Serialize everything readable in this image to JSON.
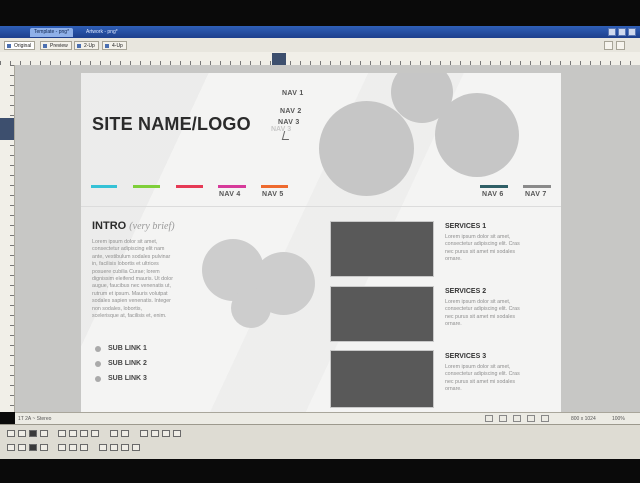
{
  "app": {
    "doc_tabs": [
      "Template - png*",
      "Artwork - png*"
    ],
    "view_buttons": [
      "Original",
      "Preview",
      "2-Up",
      "4-Up"
    ],
    "status": {
      "left": "1T 2A ~ Stereo",
      "size": "800 x 1024",
      "zoom": "100%"
    }
  },
  "design": {
    "logo": "SITE NAME/LOGO",
    "nav_top": [
      "NAV 1",
      "NAV 2",
      "NAV 3"
    ],
    "nav_bottom_left": [
      "NAV 4",
      "NAV 5"
    ],
    "nav_bottom_right": [
      "NAV 6",
      "NAV 7"
    ],
    "color_bars": [
      "#35c2d6",
      "#7fcf3a",
      "#e63a55",
      "#d63a9a",
      "#ee6a2e",
      "#2f5f66",
      "#8a8a8a"
    ],
    "intro_title": "INTRO",
    "intro_sub": "(very brief)",
    "intro_text": [
      "Lorem ipsum dolor sit amet,",
      "consectetur adipiscing elit nam",
      "ante, vestibulum sodales pulvinar",
      "in, facilisis lobortis et ultrices",
      "posuere cubilia Curae; lorem",
      "dignissim eleifend mauris. Ut dolor",
      "augue, faucibus nec venenatis ut,",
      "rutrum et ipsum. Mauris volutpat",
      "sodales sapien venenatis. Integer",
      "non sodales, lobortis,",
      "scelerisque at, facilisis et, enim."
    ],
    "sub_links": [
      "SUB LINK 1",
      "SUB LINK 2",
      "SUB LINK 3"
    ],
    "services": [
      {
        "title": "SERVICES 1",
        "text": [
          "Lorem ipsum dolor sit amet,",
          "consectetur adipiscing elit. Cras",
          "nec purus sit amet mi sodales",
          "ornare."
        ]
      },
      {
        "title": "SERVICES 2",
        "text": [
          "Lorem ipsum dolor sit amet,",
          "consectetur adipiscing elit. Cras",
          "nec purus sit amet mi sodales",
          "ornare."
        ]
      },
      {
        "title": "SERVICES 3",
        "text": [
          "Lorem ipsum dolor sit amet,",
          "consectetur adipiscing elit. Cras",
          "nec purus sit amet mi sodales",
          "ornare."
        ]
      }
    ]
  }
}
